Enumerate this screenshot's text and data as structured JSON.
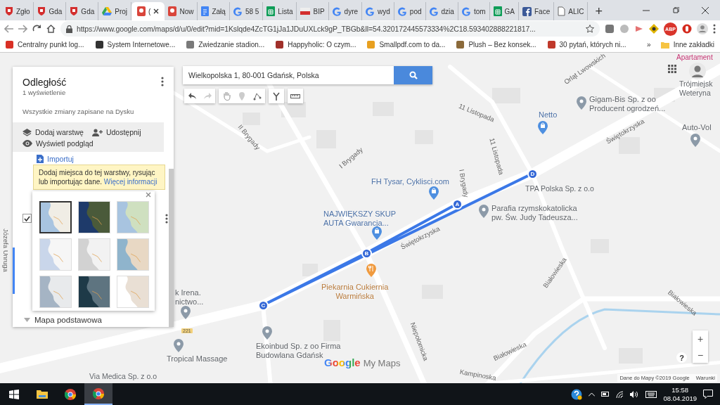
{
  "browser": {
    "tabs": [
      {
        "title": "Zgło",
        "kind": "shield",
        "selected": false
      },
      {
        "title": "Gda",
        "kind": "shield",
        "selected": false
      },
      {
        "title": "Gda",
        "kind": "shield",
        "selected": false
      },
      {
        "title": "Proj",
        "kind": "drive",
        "selected": false
      },
      {
        "title": "(",
        "kind": "maps",
        "selected": true
      },
      {
        "title": "Now",
        "kind": "maps",
        "selected": false
      },
      {
        "title": "Załą",
        "kind": "docs",
        "selected": false
      },
      {
        "title": "58 5",
        "kind": "google",
        "selected": false
      },
      {
        "title": "Lista",
        "kind": "sheets",
        "selected": false
      },
      {
        "title": "BIP",
        "kind": "flag",
        "selected": false
      },
      {
        "title": "dyre",
        "kind": "google",
        "selected": false
      },
      {
        "title": "wyd",
        "kind": "google",
        "selected": false
      },
      {
        "title": "pod",
        "kind": "google",
        "selected": false
      },
      {
        "title": "dzia",
        "kind": "google",
        "selected": false
      },
      {
        "title": "tom",
        "kind": "google",
        "selected": false
      },
      {
        "title": "GA",
        "kind": "sheets",
        "selected": false
      },
      {
        "title": "Face",
        "kind": "facebook",
        "selected": false
      },
      {
        "title": "ALIC",
        "kind": "page",
        "selected": false
      }
    ],
    "new_tab": "+",
    "url": "https://www.google.com/maps/d/u/0/edit?mid=1Kslqde4ZcTG1jJa1JDuUXLck9gP_TBGb&ll=54.320172445573334%2C18.593402888221817...",
    "extension_badge": "ABP",
    "bookmarks": [
      {
        "title": "Centralny punkt log...",
        "color": "#d93025"
      },
      {
        "title": "System Internetowe...",
        "color": "#333333"
      },
      {
        "title": "Zwiedzanie stadion...",
        "color": "#7a7a7a"
      },
      {
        "title": "Happyholic: O czym...",
        "color": "#a0302a"
      },
      {
        "title": "Smallpdf.com to da...",
        "color": "#e8a020"
      },
      {
        "title": "Plush – Bez konsek...",
        "color": "#8b6a3a"
      },
      {
        "title": "30 pytań, których ni...",
        "color": "#c0392b"
      }
    ],
    "bookmarks_overflow": "»",
    "other_bookmarks": "Inne zakładki"
  },
  "panel": {
    "title": "Odległość",
    "views": "1 wyświetlenie",
    "save_status": "Wszystkie zmiany zapisane na Dysku",
    "actions": [
      {
        "label": "Dodaj warstwę",
        "kind": "layers"
      },
      {
        "label": "Udostępnij",
        "kind": "share"
      },
      {
        "label": "Wyświetl podgląd",
        "kind": "preview"
      }
    ],
    "import_link": "Importuj",
    "tooltip": {
      "text": "Dodaj miejsca do tej warstwy, rysując lub importując dane.",
      "link": "Więcej informacji"
    },
    "layer_checked": true,
    "base_map_label": "Mapa podstawowa"
  },
  "base_map_styles": [
    {
      "kind": "map",
      "selected": true
    },
    {
      "kind": "satellite",
      "selected": false
    },
    {
      "kind": "terrain",
      "selected": false
    },
    {
      "kind": "light-political",
      "selected": false
    },
    {
      "kind": "mono-city",
      "selected": false
    },
    {
      "kind": "simple-atlas",
      "selected": false
    },
    {
      "kind": "light-landmass",
      "selected": false
    },
    {
      "kind": "dark-landmass",
      "selected": false
    },
    {
      "kind": "whitewater",
      "selected": false
    }
  ],
  "search": {
    "value": "Wielkopolska 1, 80-001 Gdańsk, Polska"
  },
  "map": {
    "places": [
      {
        "name": "Apartament",
        "kind": "hotel"
      },
      {
        "name": "Gigam-Bis Sp. z oo\nProducent ogrodzeń...",
        "kind": "business"
      },
      {
        "name": "Netto",
        "kind": "shop"
      },
      {
        "name": "Trójmiejsk\nWeteryna",
        "kind": "label"
      },
      {
        "name": "Auto-Vol",
        "kind": "business"
      },
      {
        "name": "FH Tysar, Cyklisci.com",
        "kind": "shop"
      },
      {
        "name": "TPA Polska Sp. z o.o",
        "kind": "label"
      },
      {
        "name": "Parafia rzymskokatolicka\npw. Św. Judy Tadeusza...",
        "kind": "business"
      },
      {
        "name": "NAJWIĘKSZY SKUP\nAUTA Gwarancja...",
        "kind": "shop"
      },
      {
        "name": "Piekarnia Cukiernia\nWarmińska",
        "kind": "food"
      },
      {
        "name": "k Irena.\nnictwo...",
        "kind": "business"
      },
      {
        "name": "Ekoinbud Sp. z oo Firma\nBudowlana Gdańsk",
        "kind": "business"
      },
      {
        "name": "Tropical Massage",
        "kind": "business"
      },
      {
        "name": "Via Medica Sp. z o.o",
        "kind": "label"
      }
    ],
    "streets": [
      "Orląt Lwowskich",
      "11 Listopada",
      "11 Listopada",
      "Świętokrzyska",
      "I Brygady",
      "II Brygady",
      "I Brygady",
      "Świętokrzyska",
      "Niepołomicka",
      "Białowieska",
      "Białowieska",
      "Białowieska",
      "Kampinoska",
      "Józefa Unruga"
    ],
    "road_number": "221",
    "route_points": [
      "A",
      "B",
      "C",
      "D"
    ],
    "logo_google": "Google",
    "logo_product": "My Maps",
    "zoom_in": "+",
    "zoom_out": "−",
    "help": "?",
    "attribution": "Dane do Mapy ©2019 Google",
    "terms": "Warunki"
  },
  "taskbar": {
    "time": "15:58",
    "date": "08.04.2019"
  }
}
